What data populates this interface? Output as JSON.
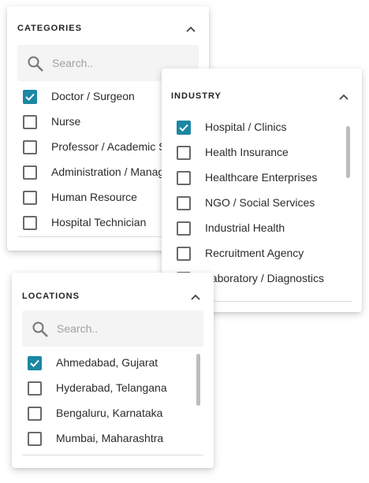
{
  "categories": {
    "title": "CATEGORIES",
    "search_placeholder": "Search..",
    "items": [
      {
        "label": "Doctor / Surgeon",
        "checked": true
      },
      {
        "label": "Nurse",
        "checked": false
      },
      {
        "label": "Professor / Academic Staff",
        "checked": false
      },
      {
        "label": "Administration / Management",
        "checked": false
      },
      {
        "label": "Human Resource",
        "checked": false
      },
      {
        "label": "Hospital Technician",
        "checked": false
      }
    ]
  },
  "industry": {
    "title": "INDUSTRY",
    "items": [
      {
        "label": "Hospital / Clinics",
        "checked": true
      },
      {
        "label": "Health Insurance",
        "checked": false
      },
      {
        "label": "Healthcare Enterprises",
        "checked": false
      },
      {
        "label": "NGO / Social Services",
        "checked": false
      },
      {
        "label": "Industrial Health",
        "checked": false
      },
      {
        "label": "Recruitment Agency",
        "checked": false
      },
      {
        "label": "Laboratory / Diagnostics",
        "checked": false
      }
    ]
  },
  "locations": {
    "title": "LOCATIONS",
    "search_placeholder": "Search..",
    "items": [
      {
        "label": "Ahmedabad, Gujarat",
        "checked": true
      },
      {
        "label": "Hyderabad, Telangana",
        "checked": false
      },
      {
        "label": "Bengaluru, Karnataka",
        "checked": false
      },
      {
        "label": "Mumbai, Maharashtra",
        "checked": false
      }
    ]
  },
  "colors": {
    "accent": "#1b87a3",
    "checkbox_border": "#6a6a6a",
    "search_bg": "#f4f4f4"
  },
  "icons": {
    "search": "search-icon",
    "collapse": "chevron-up-icon",
    "check": "checkmark-icon"
  }
}
